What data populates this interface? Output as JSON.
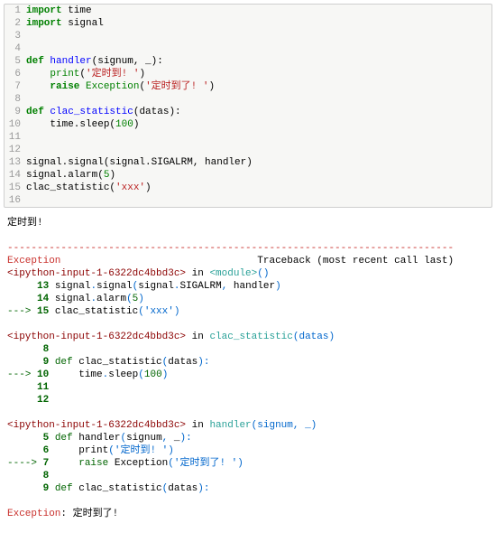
{
  "code": {
    "lines": [
      {
        "n": 1,
        "tokens": [
          [
            "import",
            "kw-green"
          ],
          [
            " time",
            ""
          ]
        ]
      },
      {
        "n": 2,
        "tokens": [
          [
            "import",
            "kw-green"
          ],
          [
            " signal",
            ""
          ]
        ]
      },
      {
        "n": 3,
        "tokens": [
          [
            "",
            ""
          ]
        ]
      },
      {
        "n": 4,
        "tokens": [
          [
            "",
            ""
          ]
        ]
      },
      {
        "n": 5,
        "tokens": [
          [
            "def",
            "kw-green"
          ],
          [
            " ",
            ""
          ],
          [
            "handler",
            "kw-blue"
          ],
          [
            "(signum, _):",
            ""
          ]
        ]
      },
      {
        "n": 6,
        "tokens": [
          [
            "    ",
            ""
          ],
          [
            "print",
            "nm-green"
          ],
          [
            "(",
            ""
          ],
          [
            "'定时到! '",
            "str"
          ],
          [
            ")",
            ""
          ]
        ]
      },
      {
        "n": 7,
        "tokens": [
          [
            "    ",
            ""
          ],
          [
            "raise",
            "kw-green"
          ],
          [
            " ",
            ""
          ],
          [
            "Exception",
            "nm-green"
          ],
          [
            "(",
            ""
          ],
          [
            "'定时到了! '",
            "str"
          ],
          [
            ")",
            ""
          ]
        ]
      },
      {
        "n": 8,
        "tokens": [
          [
            "",
            ""
          ]
        ]
      },
      {
        "n": 9,
        "tokens": [
          [
            "def",
            "kw-green"
          ],
          [
            " ",
            ""
          ],
          [
            "clac_statistic",
            "kw-blue"
          ],
          [
            "(datas):",
            ""
          ]
        ]
      },
      {
        "n": 10,
        "tokens": [
          [
            "    time.sleep(",
            ""
          ],
          [
            "100",
            "num"
          ],
          [
            ")",
            ""
          ]
        ]
      },
      {
        "n": 11,
        "tokens": [
          [
            "",
            ""
          ]
        ]
      },
      {
        "n": 12,
        "tokens": [
          [
            "",
            ""
          ]
        ]
      },
      {
        "n": 13,
        "tokens": [
          [
            "signal.signal(signal.SIGALRM, handler)",
            ""
          ]
        ]
      },
      {
        "n": 14,
        "tokens": [
          [
            "signal.alarm(",
            ""
          ],
          [
            "5",
            "num"
          ],
          [
            ")",
            ""
          ]
        ]
      },
      {
        "n": 15,
        "tokens": [
          [
            "clac_statistic(",
            ""
          ],
          [
            "'xxx'",
            "str"
          ],
          [
            ")",
            ""
          ]
        ]
      },
      {
        "n": 16,
        "tokens": [
          [
            "",
            ""
          ]
        ]
      }
    ]
  },
  "output": {
    "pre": "定时到!",
    "dash_line": "---------------------------------------------------------------------------",
    "header_left": "Exception",
    "header_right": "Traceback (most recent call last)",
    "frames": [
      {
        "loc": {
          "file": "<ipython-input-1-6322dc4bbd3c>",
          "in": " in ",
          "fn": "<module>",
          "args": "()"
        },
        "lines": [
          {
            "arrow": "     ",
            "n": "13",
            "tokens": [
              [
                " signal",
                ""
              ],
              [
                ".",
                "iblue"
              ],
              [
                "signal",
                ""
              ],
              [
                "(",
                "iblue"
              ],
              [
                "signal",
                ""
              ],
              [
                ".",
                "iblue"
              ],
              [
                "SIGALRM",
                ""
              ],
              [
                ",",
                "iblue"
              ],
              [
                " handler",
                ""
              ],
              [
                ")",
                "iblue"
              ]
            ]
          },
          {
            "arrow": "     ",
            "n": "14",
            "tokens": [
              [
                " signal",
                ""
              ],
              [
                ".",
                "iblue"
              ],
              [
                "alarm",
                ""
              ],
              [
                "(",
                "iblue"
              ],
              [
                "5",
                "tgreen"
              ],
              [
                ")",
                "iblue"
              ]
            ]
          },
          {
            "arrow": "---> ",
            "n": "15",
            "tokens": [
              [
                " clac_statistic",
                ""
              ],
              [
                "(",
                "iblue"
              ],
              [
                "'xxx'",
                "iblue"
              ],
              [
                ")",
                "iblue"
              ]
            ]
          }
        ]
      },
      {
        "loc": {
          "file": "<ipython-input-1-6322dc4bbd3c>",
          "in": " in ",
          "fn": "clac_statistic",
          "args": "(datas)"
        },
        "lines": [
          {
            "arrow": "      ",
            "n": "8",
            "tokens": [
              [
                "",
                ""
              ]
            ]
          },
          {
            "arrow": "      ",
            "n": "9",
            "tokens": [
              [
                " ",
                ""
              ],
              [
                "def",
                "tgreen"
              ],
              [
                " clac_statistic",
                ""
              ],
              [
                "(",
                "iblue"
              ],
              [
                "datas",
                ""
              ],
              [
                "):",
                "iblue"
              ]
            ]
          },
          {
            "arrow": "---> ",
            "n": "10",
            "tokens": [
              [
                "     time",
                ""
              ],
              [
                ".",
                "iblue"
              ],
              [
                "sleep",
                ""
              ],
              [
                "(",
                "iblue"
              ],
              [
                "100",
                "tgreen"
              ],
              [
                ")",
                "iblue"
              ]
            ]
          },
          {
            "arrow": "     ",
            "n": "11",
            "tokens": [
              [
                "",
                ""
              ]
            ]
          },
          {
            "arrow": "     ",
            "n": "12",
            "tokens": [
              [
                "",
                ""
              ]
            ]
          }
        ]
      },
      {
        "loc": {
          "file": "<ipython-input-1-6322dc4bbd3c>",
          "in": " in ",
          "fn": "handler",
          "args": "(signum, _)"
        },
        "lines": [
          {
            "arrow": "      ",
            "n": "5",
            "tokens": [
              [
                " ",
                ""
              ],
              [
                "def",
                "tgreen"
              ],
              [
                " handler",
                ""
              ],
              [
                "(",
                "iblue"
              ],
              [
                "signum",
                ""
              ],
              [
                ",",
                "iblue"
              ],
              [
                " _",
                ""
              ],
              [
                "):",
                "iblue"
              ]
            ]
          },
          {
            "arrow": "      ",
            "n": "6",
            "tokens": [
              [
                "     print",
                ""
              ],
              [
                "(",
                "iblue"
              ],
              [
                "'定时到! '",
                "iblue"
              ],
              [
                ")",
                "iblue"
              ]
            ]
          },
          {
            "arrow": "----> ",
            "n": "7",
            "tokens": [
              [
                "     ",
                ""
              ],
              [
                "raise",
                "tgreen"
              ],
              [
                " Exception",
                ""
              ],
              [
                "(",
                "iblue"
              ],
              [
                "'定时到了! '",
                "iblue"
              ],
              [
                ")",
                "iblue"
              ]
            ]
          },
          {
            "arrow": "      ",
            "n": "8",
            "tokens": [
              [
                "",
                ""
              ]
            ]
          },
          {
            "arrow": "      ",
            "n": "9",
            "tokens": [
              [
                " ",
                ""
              ],
              [
                "def",
                "tgreen"
              ],
              [
                " clac_statistic",
                ""
              ],
              [
                "(",
                "iblue"
              ],
              [
                "datas",
                ""
              ],
              [
                "):",
                "iblue"
              ]
            ]
          }
        ]
      }
    ],
    "final_label": "Exception",
    "final_sep": ": ",
    "final_msg": "定时到了! "
  }
}
